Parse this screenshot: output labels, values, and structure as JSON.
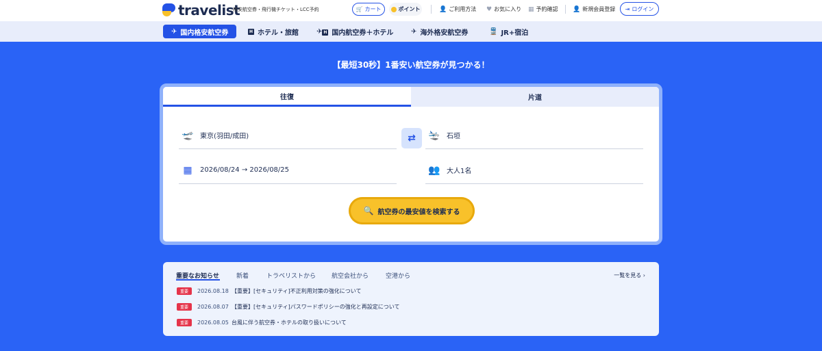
{
  "header": {
    "logo_text": "travelist",
    "tagline": "格安航空券・飛行機チケット・LCC予約",
    "cart_label": "カート",
    "point_label": "ポイント",
    "links": [
      {
        "label": "ご利用方法",
        "icon": "user-icon"
      },
      {
        "label": "お気に入り",
        "icon": "heart-icon"
      },
      {
        "label": "予約確認",
        "icon": "calendar-icon"
      },
      {
        "label": "新規会員登録",
        "icon": "user-plus-icon"
      }
    ],
    "login_label": "ログイン"
  },
  "nav": {
    "items": [
      {
        "label": "国内格安航空券",
        "icon": "plane-icon",
        "active": true
      },
      {
        "label": "ホテル・旅館",
        "icon": "hotel-icon"
      },
      {
        "label": "国内航空券＋ホテル",
        "icon": "plane-hotel-icon"
      },
      {
        "label": "海外格安航空券",
        "icon": "plane-globe-icon"
      },
      {
        "label": "JR+宿泊",
        "icon": "train-icon"
      }
    ]
  },
  "hero": {
    "title": "【最短30秒】1番安い航空券が見つかる！"
  },
  "search": {
    "tabs": [
      "往復",
      "片道"
    ],
    "from": "東京(羽田/成田)",
    "to": "石垣",
    "dates": "2026/08/24 → 2026/08/25",
    "passengers": "大人1名",
    "button_label": "航空券の最安値を検索する"
  },
  "news": {
    "tabs": [
      "重要なお知らせ",
      "新着",
      "トラベリストから",
      "航空会社から",
      "空港から"
    ],
    "more_label": "一覧を見る ›",
    "items": [
      {
        "badge": "重要",
        "date": "2026.08.18",
        "title": "【重要】[セキュリティ]不正利用対策の強化について"
      },
      {
        "badge": "重要",
        "date": "2026.08.07",
        "title": "【重要】[セキュリティ]パスワードポリシーの強化と再設定について"
      },
      {
        "badge": "重要",
        "date": "2026.08.05",
        "title": "台風に伴う航空券・ホテルの取り扱いについて"
      }
    ]
  },
  "colors": {
    "primary": "#2452e6",
    "hero_bg": "#2a63f6",
    "accent": "#f8c12a",
    "badge": "#e5344a"
  }
}
